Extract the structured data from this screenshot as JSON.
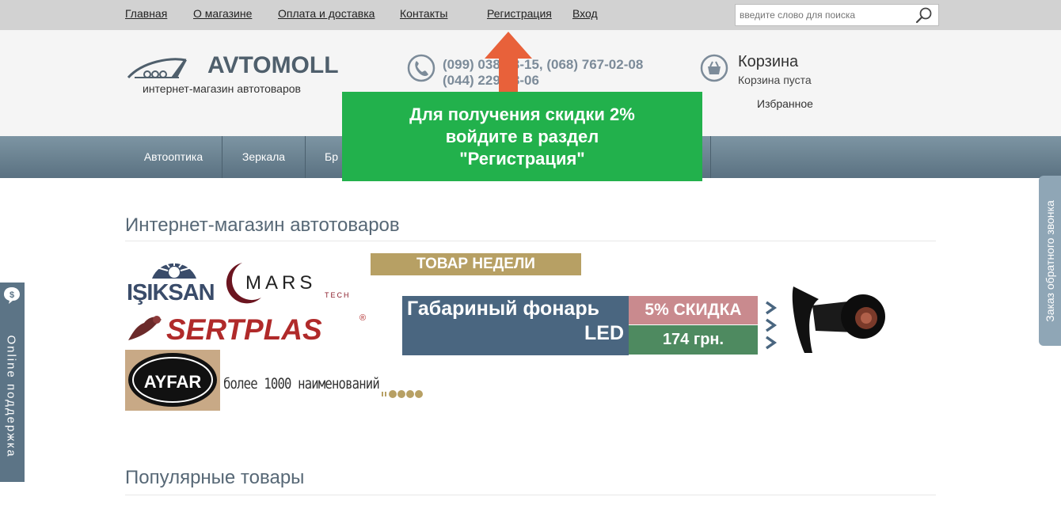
{
  "topnav": {
    "links": [
      "Главная",
      "О магазине",
      "Оплата и доставка",
      "Контакты",
      "Регистрация",
      "Вход"
    ]
  },
  "search": {
    "placeholder": "введите слово для поиска"
  },
  "header": {
    "logo_text": "AVTOMOLL",
    "logo_subtitle": "интернет-магазин автотоваров",
    "phone_line1": "(099) 038-23-15, (068) 767-02-08",
    "phone_line2": "(044) 229-58-06",
    "cart_title": "Корзина",
    "cart_status": "Корзина пуста",
    "favorites": "Избранное"
  },
  "nav": {
    "items": [
      "Автооптика",
      "Зеркала",
      "Бр"
    ]
  },
  "promo": {
    "line1": "Для получения скидки 2%",
    "line2": "войдите в раздел",
    "line3": "\"Регистрация\""
  },
  "main": {
    "title": "Интернет-магазин автотоваров",
    "popular_title": "Популярные товары"
  },
  "banner": {
    "brand1": "IŞIKSAN",
    "brand2": "MARS",
    "brand2_sub": "TECH",
    "brand3": "SERTPLAS",
    "brand4": "AYFAR",
    "more": "более 1000 наименований",
    "week": "ТОВАР НЕДЕЛИ",
    "product_line1": "Габариный фонарь",
    "product_line2": "LED",
    "discount": "5% СКИДКА",
    "price": "174 грн."
  },
  "side": {
    "callback": "Заказ обратного звонка",
    "support": "Online поддержка"
  },
  "colors": {
    "accent": "#22b14c",
    "nav": "#6a8393",
    "arrow": "#e8613a"
  }
}
